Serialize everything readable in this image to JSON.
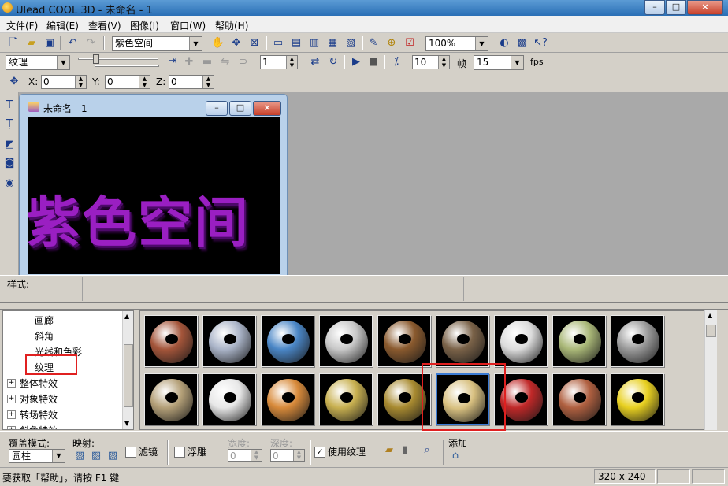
{
  "window": {
    "title": "Ulead COOL 3D - 未命名 - 1",
    "minimize_glyph": "–",
    "maximize_glyph": "□",
    "close_glyph": "×"
  },
  "menu": [
    "文件(F)",
    "编辑(E)",
    "查看(V)",
    "图像(I)",
    "窗口(W)",
    "帮助(H)"
  ],
  "toolbar1": {
    "text_combo": "紫色空间",
    "zoom_combo": "100%"
  },
  "toolbar2": {
    "attribute_combo": "纹理",
    "frame_value": "1",
    "frames_total": "10",
    "frame_label": "帧",
    "fps_value": "15",
    "fps_label": "fps"
  },
  "toolbar3": {
    "x_label": "X:",
    "x_value": "0",
    "y_label": "Y:",
    "y_value": "0",
    "z_label": "Z:",
    "z_value": "0"
  },
  "document": {
    "title": "未命名 - 1",
    "canvas_text": "紫色空间",
    "canvas_text_color": "#9a1fc2"
  },
  "styles_panel": {
    "label": "样式:"
  },
  "effects_tree": [
    {
      "label": "画廊",
      "level": 1
    },
    {
      "label": "斜角",
      "level": 1
    },
    {
      "label": "光线和色彩",
      "level": 1
    },
    {
      "label": "纹理",
      "level": 1,
      "selected": true
    },
    {
      "label": "整体特效",
      "level": 0,
      "expander": "+"
    },
    {
      "label": "对象特效",
      "level": 0,
      "expander": "+"
    },
    {
      "label": "转场特效",
      "level": 0,
      "expander": "+"
    },
    {
      "label": "斜角特效",
      "level": 0,
      "expander": "+"
    }
  ],
  "textures": [
    {
      "name": "brick",
      "color": "#a4553a"
    },
    {
      "name": "silver-pattern",
      "color": "#aab4c8"
    },
    {
      "name": "blue-stone",
      "color": "#4a86c6"
    },
    {
      "name": "white-brick",
      "color": "#c8c8c8"
    },
    {
      "name": "wood-stripe",
      "color": "#8a5a2e"
    },
    {
      "name": "rock",
      "color": "#7a6248"
    },
    {
      "name": "white-marble",
      "color": "#dcdcdc"
    },
    {
      "name": "green-lichen",
      "color": "#aab878"
    },
    {
      "name": "gray-granite",
      "color": "#9a9a9a"
    },
    {
      "name": "burlap",
      "color": "#b4a078"
    },
    {
      "name": "chrome",
      "color": "#e8e8e8"
    },
    {
      "name": "copper",
      "color": "#d88a3a"
    },
    {
      "name": "gold",
      "color": "#c8b050"
    },
    {
      "name": "dark-gold",
      "color": "#a88a30"
    },
    {
      "name": "gold-shiny",
      "color": "#d8c080",
      "selected": true
    },
    {
      "name": "red-brick",
      "color": "#c02828"
    },
    {
      "name": "terracotta",
      "color": "#b06040"
    },
    {
      "name": "yellow",
      "color": "#e8d020"
    }
  ],
  "options": {
    "overlay_label": "覆盖模式:",
    "overlay_value": "圆柱",
    "mapping_label": "映射:",
    "filter_label": "滤镜",
    "emboss_label": "浮雕",
    "width_label": "宽度:",
    "width_value": "0",
    "depth_label": "深度:",
    "depth_value": "0",
    "use_texture_label": "使用纹理",
    "add_label": "添加"
  },
  "status": {
    "help_text": "要获取「帮助」，请按 F1 键",
    "size_text": "320 x 240"
  },
  "colors": {
    "highlight_red": "#e02020",
    "selection_blue": "#3a7bd5"
  }
}
